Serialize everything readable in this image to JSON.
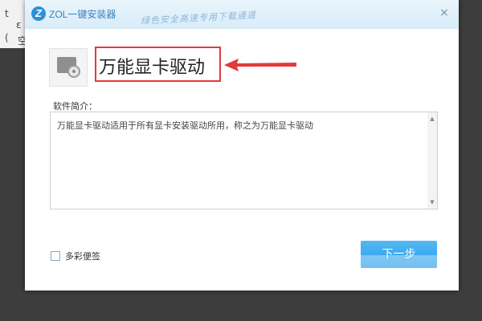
{
  "window": {
    "logo_mark": "Z",
    "app_name": "ZOL一键安装器",
    "slogan": "绿色安全高速专用下载通道",
    "close_icon": "×"
  },
  "background": {
    "chars": [
      "t",
      "ɛ",
      "(",
      "空"
    ]
  },
  "software": {
    "title": "万能显卡驱动",
    "desc_label": "软件简介：",
    "description": "万能显卡驱动适用于所有显卡安装驱动所用，称之为万能显卡驱动"
  },
  "footer": {
    "checkbox_label": "多彩便签",
    "next_button": "下一步"
  },
  "colors": {
    "accent": "#2a9de8",
    "highlight_box": "#e23a3a"
  },
  "icons": {
    "app": "hard-drive-disc-icon",
    "close": "close-icon",
    "arrow": "red-arrow-icon"
  }
}
